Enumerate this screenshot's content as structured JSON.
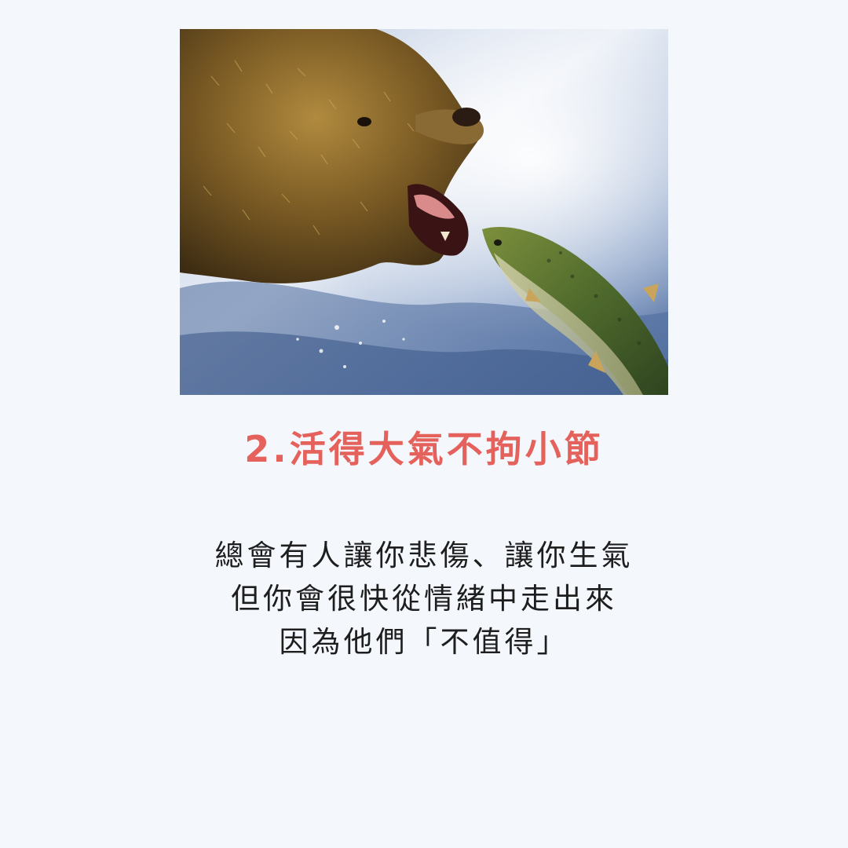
{
  "photo": {
    "subject": "bear-catching-salmon-photo"
  },
  "heading": {
    "text": "2.活得大氣不拘小節",
    "color": "#e5625c"
  },
  "body": {
    "lines": [
      "總會有人讓你悲傷、讓你生氣",
      "但你會很快從情緒中走出來",
      "因為他們「不值得」"
    ]
  },
  "colors": {
    "background": "#f4f8fd",
    "text": "#1e1e1e"
  }
}
